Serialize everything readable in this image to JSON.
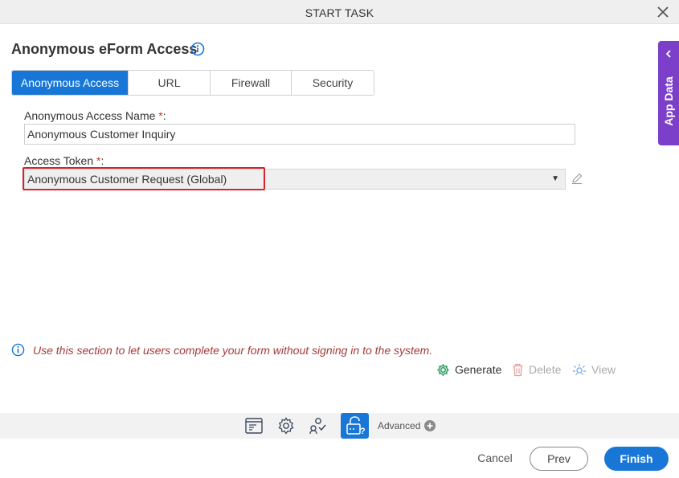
{
  "window": {
    "title": "START TASK"
  },
  "page": {
    "heading": "Anonymous eForm Access"
  },
  "tabs": [
    {
      "label": "Anonymous Access",
      "active": true
    },
    {
      "label": "URL",
      "active": false
    },
    {
      "label": "Firewall",
      "active": false
    },
    {
      "label": "Security",
      "active": false
    }
  ],
  "form": {
    "name_label": "Anonymous Access Name",
    "name_value": "Anonymous Customer Inquiry",
    "token_label": "Access Token",
    "token_value": "Anonymous Customer Request (Global)",
    "required_mark": "*",
    "label_suffix": ":"
  },
  "side_panel": {
    "label": "App Data"
  },
  "note": {
    "text": "Use this section to let users complete your form without signing in to the system."
  },
  "actions": {
    "generate": "Generate",
    "delete": "Delete",
    "view": "View"
  },
  "toolbar": {
    "advanced_label": "Advanced"
  },
  "footer": {
    "cancel": "Cancel",
    "prev": "Prev",
    "finish": "Finish"
  },
  "colors": {
    "accent": "#1877d6",
    "app_data": "#7b3fc9",
    "note_text": "#a33a3a",
    "highlight": "#d9232a"
  }
}
